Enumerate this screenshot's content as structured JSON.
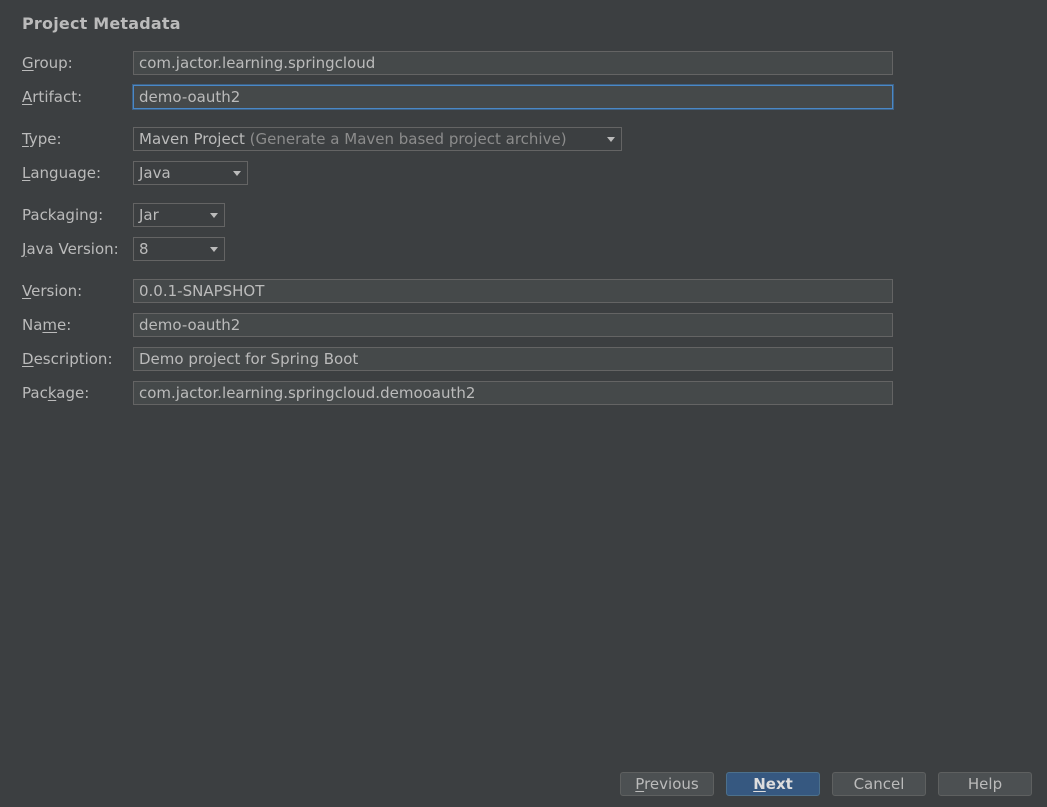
{
  "section": {
    "title": "Project Metadata"
  },
  "form": {
    "group": {
      "mnemonic": "G",
      "rest": "roup:",
      "value": "com.jactor.learning.springcloud"
    },
    "artifact": {
      "mnemonic": "A",
      "rest": "rtifact:",
      "value": "demo-oauth2"
    },
    "type": {
      "mnemonic": "T",
      "rest": "ype:",
      "value": "Maven Project",
      "hint": "(Generate a Maven based project archive)"
    },
    "language": {
      "pre": "",
      "mnemonic": "L",
      "rest": "anguage:",
      "value": "Java"
    },
    "packaging": {
      "label": "Packaging:",
      "value": "Jar"
    },
    "java_version": {
      "mnemonic": "J",
      "rest": "ava Version:",
      "value": "8"
    },
    "version": {
      "mnemonic": "V",
      "rest": "ersion:",
      "value": "0.0.1-SNAPSHOT"
    },
    "name": {
      "pre": "Na",
      "mnemonic": "m",
      "rest": "e:",
      "value": "demo-oauth2"
    },
    "description": {
      "mnemonic": "D",
      "rest": "escription:",
      "value": "Demo project for Spring Boot"
    },
    "package": {
      "pre": "Pac",
      "mnemonic": "k",
      "rest": "age:",
      "value": "com.jactor.learning.springcloud.demooauth2"
    }
  },
  "buttons": {
    "previous": {
      "mnemonic": "P",
      "rest": "revious"
    },
    "next": {
      "mnemonic": "N",
      "rest": "ext"
    },
    "cancel": {
      "label": "Cancel"
    },
    "help": {
      "label": "Help"
    }
  }
}
